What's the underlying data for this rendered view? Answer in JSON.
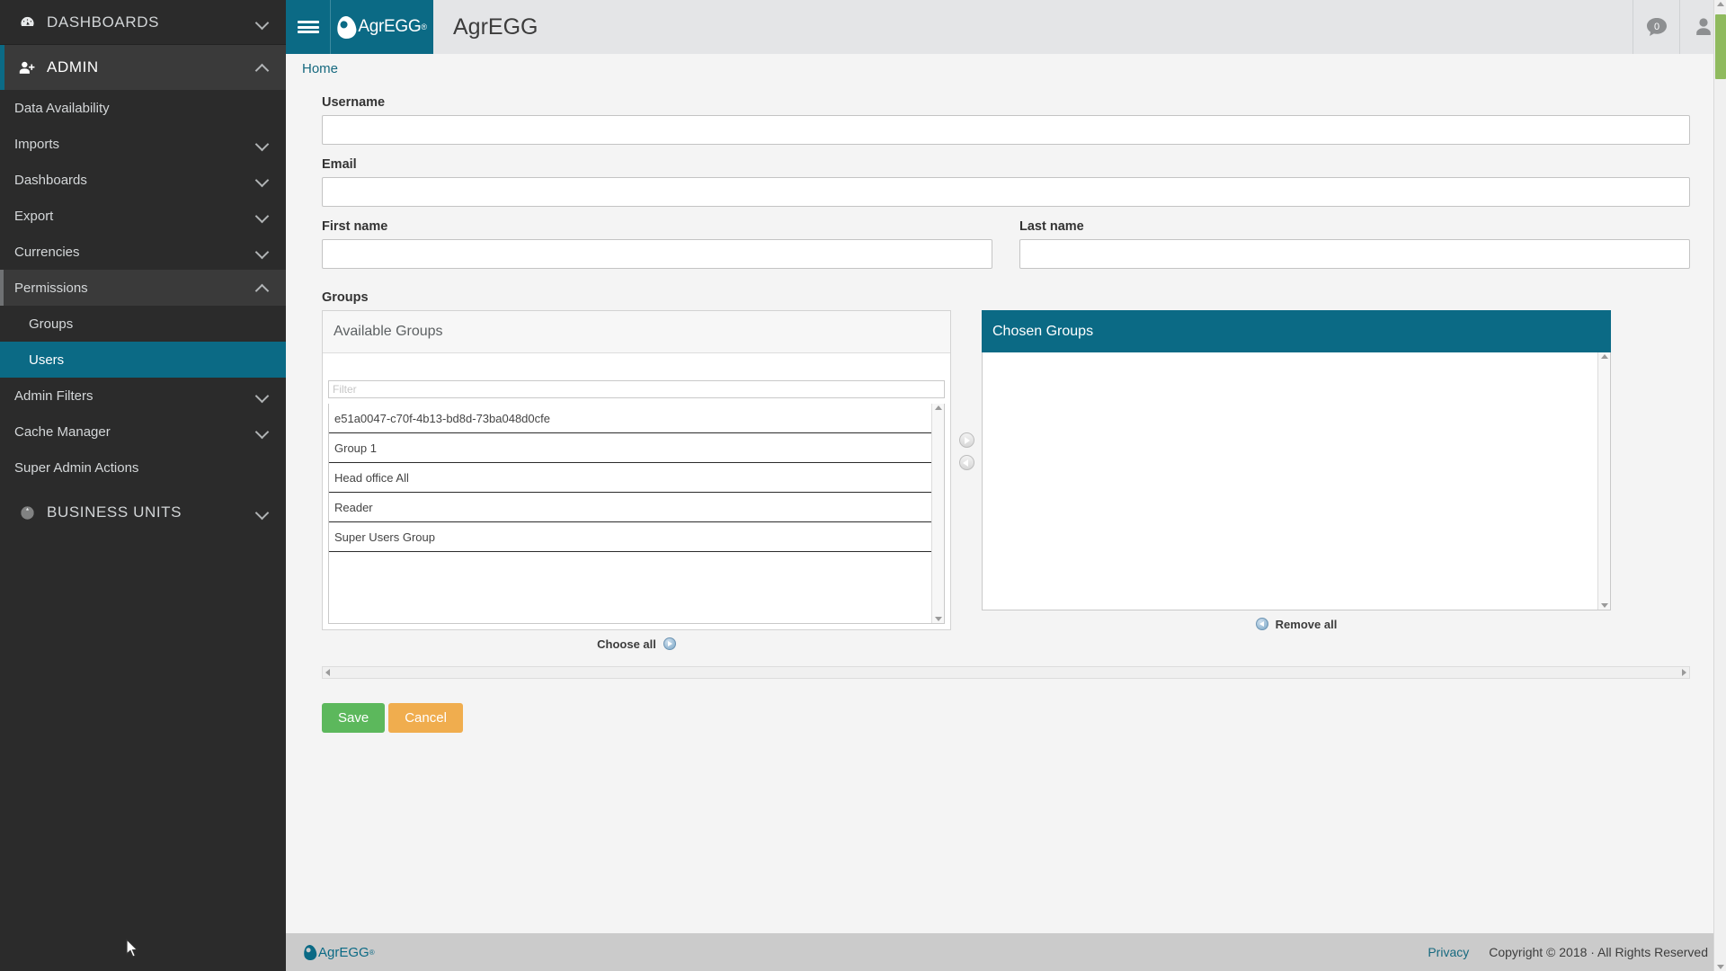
{
  "app": {
    "brand_name": "AgrEGG",
    "brand_sup": "®",
    "title": "AgrEGG",
    "accent_teal": "#0b6a85",
    "sidebar_bg": "#2b2b2b"
  },
  "topbar": {
    "hamburger_label": "menu-toggle",
    "message_count": "0",
    "user_icon_label": "user"
  },
  "breadcrumb": {
    "home": "Home"
  },
  "form": {
    "username": {
      "label": "Username",
      "value": "",
      "placeholder": ""
    },
    "email": {
      "label": "Email",
      "value": "",
      "placeholder": ""
    },
    "first_name": {
      "label": "First name",
      "value": "",
      "placeholder": ""
    },
    "last_name": {
      "label": "Last name",
      "value": "",
      "placeholder": ""
    },
    "groups_label": "Groups"
  },
  "groups_widget": {
    "available_title": "Available Groups",
    "chosen_title": "Chosen Groups",
    "filter_placeholder": "Filter",
    "filter_value": "",
    "choose_all_label": "Choose all",
    "remove_all_label": "Remove all",
    "available_items": [
      "e51a0047-c70f-4b13-bd8d-73ba048d0cfe",
      "Group 1",
      "Head office All",
      "Reader",
      "Super Users Group"
    ],
    "chosen_items": []
  },
  "actions": {
    "save_label": "Save",
    "cancel_label": "Cancel"
  },
  "sidebar": {
    "sections": [
      {
        "label": "DASHBOARDS",
        "icon": "dashboard-icon",
        "expanded": false,
        "active": false
      },
      {
        "label": "ADMIN",
        "icon": "user-add-icon",
        "expanded": true,
        "active": true
      }
    ],
    "admin_items": [
      {
        "label": "Data Availability",
        "has_chevron": false,
        "expanded": false
      },
      {
        "label": "Imports",
        "has_chevron": true,
        "expanded": false
      },
      {
        "label": "Dashboards",
        "has_chevron": true,
        "expanded": false
      },
      {
        "label": "Export",
        "has_chevron": true,
        "expanded": false
      },
      {
        "label": "Currencies",
        "has_chevron": true,
        "expanded": false
      },
      {
        "label": "Permissions",
        "has_chevron": true,
        "expanded": true
      }
    ],
    "permissions_subitems": [
      {
        "label": "Groups",
        "selected": false
      },
      {
        "label": "Users",
        "selected": true
      }
    ],
    "admin_items_tail": [
      {
        "label": "Admin Filters",
        "has_chevron": true,
        "expanded": false
      },
      {
        "label": "Cache Manager",
        "has_chevron": true,
        "expanded": false
      },
      {
        "label": "Super Admin Actions",
        "has_chevron": false,
        "expanded": false
      }
    ],
    "bottom_section": {
      "label": "BUSINESS UNITS",
      "icon": "globe-icon",
      "expanded": false
    }
  },
  "footer": {
    "brand": "AgrEGG",
    "brand_sup": "®",
    "privacy": "Privacy",
    "copyright": "Copyright © 2018 · All Rights Reserved"
  }
}
